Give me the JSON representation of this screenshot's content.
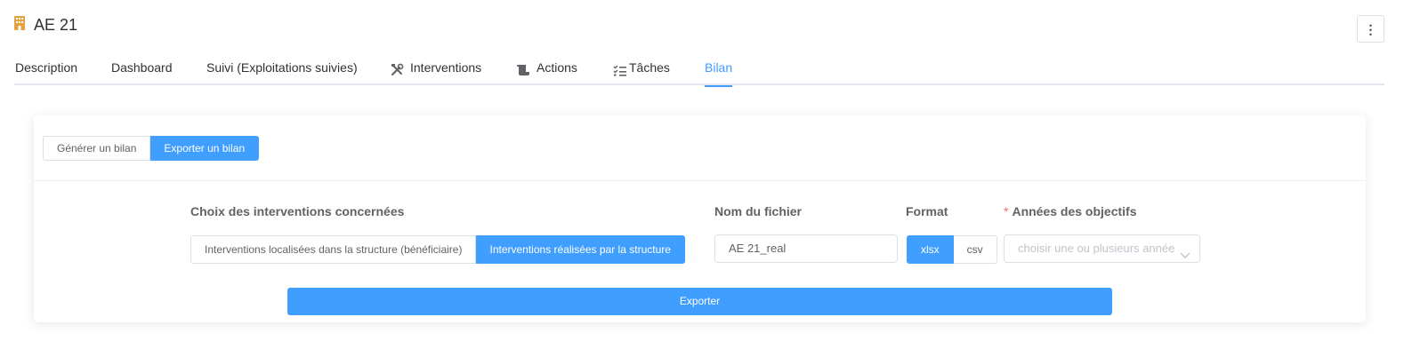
{
  "header": {
    "title": "AE 21",
    "icon": "building-icon",
    "icon_color": "#e6a23c"
  },
  "menu_button": {
    "label": "⋮",
    "icon": "more-vertical-icon"
  },
  "tabs": [
    {
      "label": "Description"
    },
    {
      "label": "Dashboard"
    },
    {
      "label": "Suivi (Exploitations suivies)"
    },
    {
      "label": "Interventions",
      "icon": "tools-icon"
    },
    {
      "label": "Actions",
      "icon": "scroll-icon"
    },
    {
      "label": "Tâches",
      "icon": "checklist-icon"
    },
    {
      "label": "Bilan",
      "active": true
    }
  ],
  "bilan": {
    "mode_buttons": [
      {
        "label": "Générer un bilan"
      },
      {
        "label": "Exporter un bilan",
        "active": true
      }
    ],
    "interventions_label": "Choix des interventions concernées",
    "intervention_options": [
      {
        "label": "Interventions localisées dans la structure (bénéficiaire)"
      },
      {
        "label": "Interventions réalisées par la structure",
        "active": true
      }
    ],
    "filename_label": "Nom du fichier",
    "filename_value": "AE 21_real",
    "format_label": "Format",
    "format_options": [
      {
        "label": "xlsx",
        "active": true
      },
      {
        "label": "csv"
      }
    ],
    "years_required_mark": "*",
    "years_label": "Années des objectifs",
    "years_placeholder": "choisir une ou plusieurs années",
    "export_label": "Exporter"
  },
  "colors": {
    "accent": "#409eff",
    "border": "#dcdfe6",
    "required": "#f56c6c"
  }
}
